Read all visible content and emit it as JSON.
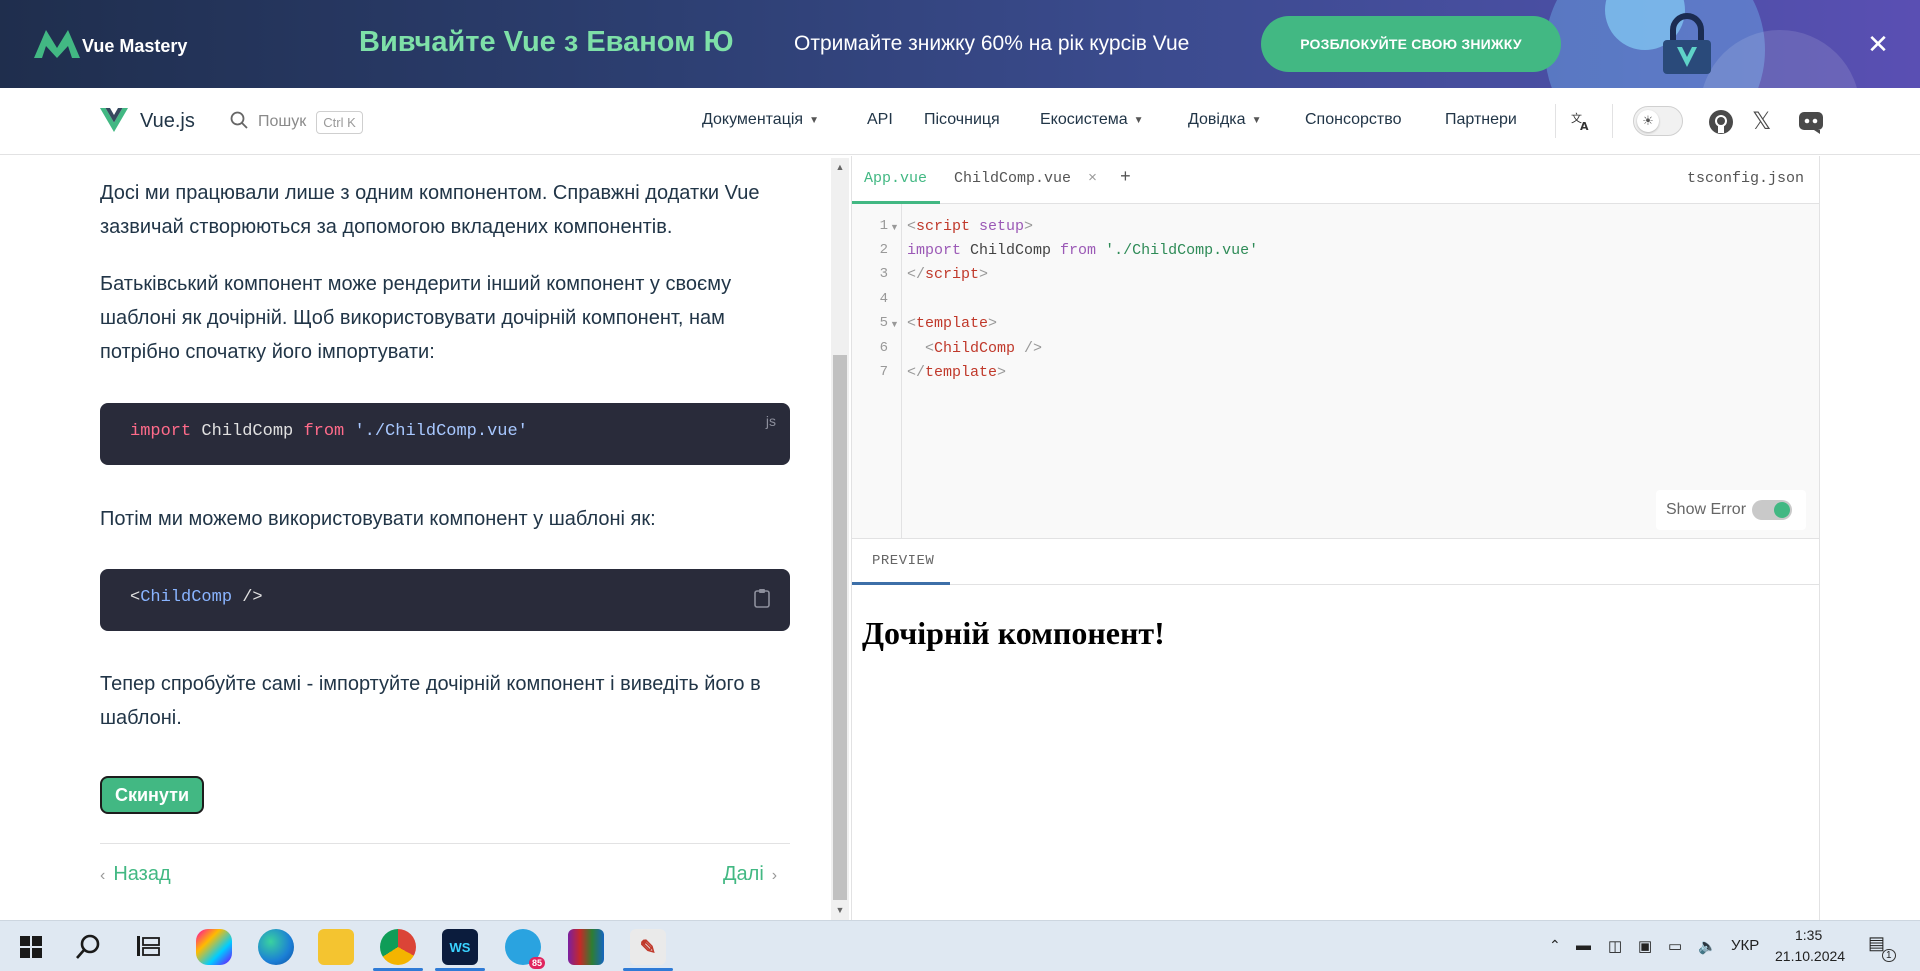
{
  "banner": {
    "brand": "Vue Mastery",
    "title": "Вивчайте Vue з Еваном Ю",
    "subtitle": "Отримайте знижку 60% на рік курсів Vue",
    "cta": "РОЗБЛОКУЙТЕ СВОЮ ЗНИЖКУ",
    "close": "✕"
  },
  "nav": {
    "site_title": "Vue.js",
    "search_label": "Пошук",
    "search_kbd": "Ctrl K",
    "items": [
      {
        "label": "Документація",
        "dropdown": true
      },
      {
        "label": "API",
        "dropdown": false
      },
      {
        "label": "Пісочниця",
        "dropdown": false
      },
      {
        "label": "Екосистема",
        "dropdown": true
      },
      {
        "label": "Довідка",
        "dropdown": true
      },
      {
        "label": "Спонсорство",
        "dropdown": false
      },
      {
        "label": "Партнери",
        "dropdown": false
      }
    ],
    "icons": [
      "translate-icon",
      "theme-toggle",
      "github-icon",
      "x-twitter-icon",
      "discord-icon"
    ]
  },
  "tutorial": {
    "p1": "Досі ми працювали лише з одним компонентом. Справжні додатки Vue зазвичай створюються за допомогою вкладених компонентів.",
    "p2": "Батьківський компонент може рендерити інший компонент у своєму шаблоні як дочірній. Щоб використовувати дочірній компонент, нам потрібно спочатку його імпортувати:",
    "code1": {
      "kw1": "import",
      "ident": " ChildComp ",
      "kw2": "from",
      "space": " ",
      "str": "'./ChildComp.vue'",
      "lang": "js"
    },
    "p3": "Потім ми можемо використовувати компонент у шаблоні як:",
    "code2": {
      "open": "<",
      "tag": "ChildComp",
      "close": " />"
    },
    "p4": "Тепер спробуйте самі - імпортуйте дочірній компонент і виведіть його в шаблоні.",
    "reset": "Скинути",
    "prev": "Назад",
    "next": "Далі",
    "prev_icon": "‹",
    "next_icon": "›"
  },
  "editor": {
    "tabs": [
      "App.vue",
      "ChildComp.vue"
    ],
    "close_icon": "×",
    "add_icon": "+",
    "tsconfig": "tsconfig.json",
    "line_numbers": [
      "1",
      "2",
      "3",
      "4",
      "5",
      "6",
      "7"
    ],
    "lines": {
      "l1": {
        "a": "<",
        "b": "script",
        "c": " setup",
        "d": ">"
      },
      "l2": {
        "a": "import",
        "b": " ChildComp ",
        "c": "from",
        "d": " ",
        "e": "'./ChildComp.vue'"
      },
      "l3": {
        "a": "</",
        "b": "script",
        "c": ">"
      },
      "l5": {
        "a": "<",
        "b": "template",
        "c": ">"
      },
      "l6": {
        "a": "  <",
        "b": "ChildComp",
        "c": " />"
      },
      "l7": {
        "a": "</",
        "b": "template",
        "c": ">"
      }
    },
    "show_error": "Show Error"
  },
  "preview": {
    "tab": "PREVIEW",
    "heading": "Дочірній компонент!"
  },
  "taskbar": {
    "lang": "УКР",
    "time": "1:35",
    "date": "21.10.2024",
    "telegram_badge": "85",
    "notif_badge": "1"
  }
}
